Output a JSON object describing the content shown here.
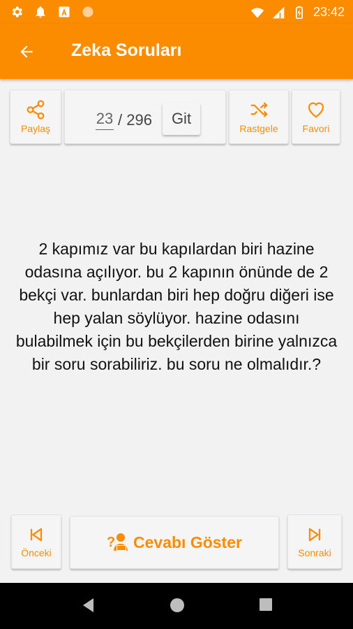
{
  "status_bar": {
    "time": "23:42",
    "icons": [
      "settings-icon",
      "notification-bell-icon",
      "app-a-icon",
      "circle-icon",
      "wifi-icon",
      "signal-icon",
      "battery-charging-icon"
    ]
  },
  "app_bar": {
    "title": "Zeka Soruları",
    "back_icon": "arrow-left-icon"
  },
  "toolbar": {
    "share_label": "Paylaş",
    "current_page": "23",
    "separator_total": "/ 296",
    "go_label": "Git",
    "random_label": "Rastgele",
    "favorite_label": "Favori"
  },
  "question": {
    "text": "2 kapımız var bu kapılardan biri hazine odasına açılıyor. bu 2 kapının önünde de 2 bekçi var. bunlardan biri hep doğru diğeri ise hep yalan söylüyor. hazine odasını bulabilmek için bu bekçilerden birine yalnızca bir soru sorabiliriz. bu soru ne olmalıdır.?"
  },
  "bottom": {
    "prev_label": "Önceki",
    "answer_label": "Cevabı Göster",
    "next_label": "Sonraki"
  },
  "colors": {
    "accent": "#fb8c00",
    "background": "#f2f2f2",
    "nav_bar": "#000000"
  }
}
